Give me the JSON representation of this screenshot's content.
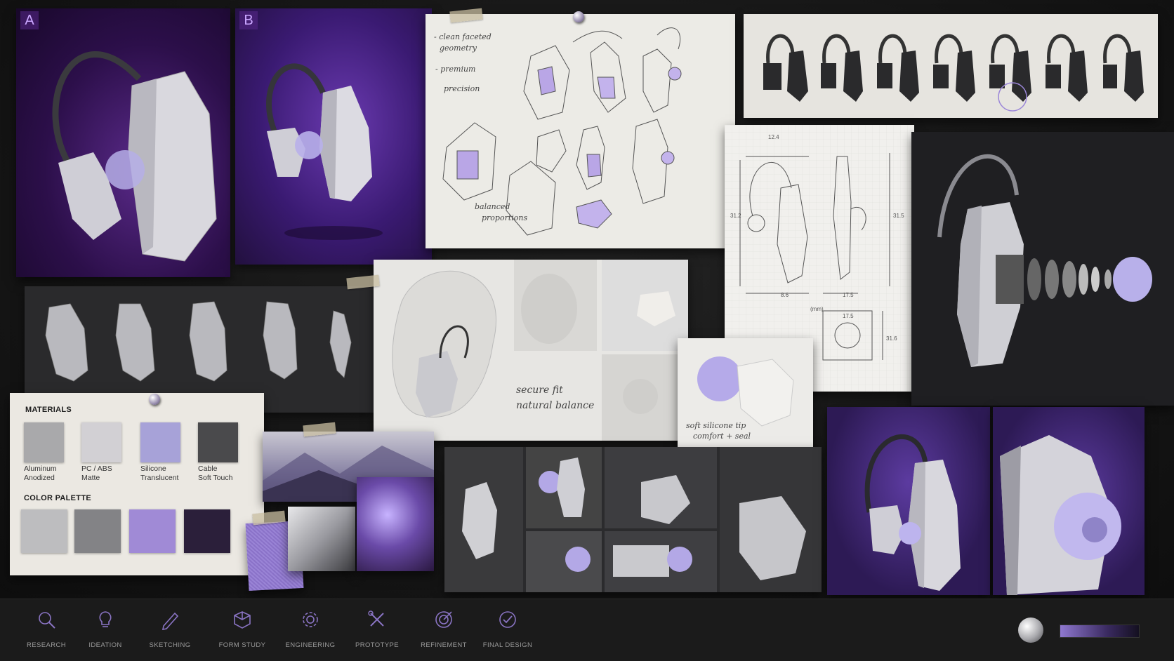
{
  "concepts": {
    "a": "A",
    "b": "B"
  },
  "sketch_notes": {
    "n1": "- clean faceted",
    "n2": "geometry",
    "n3": "- premium",
    "n4": "precision",
    "n5": "balanced",
    "n6": "proportions"
  },
  "drawing": {
    "d1": "12.4",
    "d2": "31.2",
    "d3": "31.5",
    "d4": "8.6",
    "d5": "17.5",
    "unit": "(mm)",
    "d6": "17.5",
    "d7": "31.6"
  },
  "fit_notes": {
    "line1": "secure fit",
    "line2": "natural balance"
  },
  "tip_notes": {
    "line1": "soft silicone tip",
    "line2": "comfort + seal"
  },
  "materials": {
    "title": "MATERIALS",
    "items": [
      {
        "name": "Aluminum",
        "finish": "Anodized",
        "color": "#a9a9ab"
      },
      {
        "name": "PC / ABS",
        "finish": "Matte",
        "color": "#d2d0d4"
      },
      {
        "name": "Silicone",
        "finish": "Translucent",
        "color": "#a7a2d8"
      },
      {
        "name": "Cable",
        "finish": "Soft Touch",
        "color": "#4a4a4c"
      }
    ]
  },
  "palette": {
    "title": "COLOR PALETTE",
    "colors": [
      "#bdbdbf",
      "#838386",
      "#a08ad6",
      "#2b1f3a"
    ]
  },
  "process": [
    {
      "label": "RESEARCH",
      "icon": "magnifier-icon"
    },
    {
      "label": "IDEATION",
      "icon": "lightbulb-icon"
    },
    {
      "label": "SKETCHING",
      "icon": "pencil-icon"
    },
    {
      "label": "FORM STUDY",
      "icon": "cube-icon"
    },
    {
      "label": "ENGINEERING",
      "icon": "gear-icon"
    },
    {
      "label": "PROTOTYPE",
      "icon": "tools-icon"
    },
    {
      "label": "REFINEMENT",
      "icon": "target-icon"
    },
    {
      "label": "FINAL DESIGN",
      "icon": "check-circle-icon"
    }
  ],
  "accent": "#7a5cc0"
}
